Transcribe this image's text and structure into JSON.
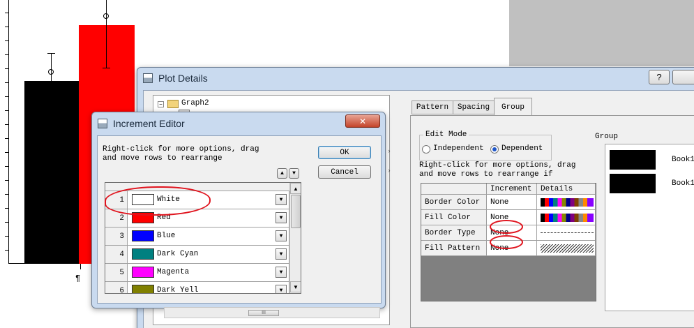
{
  "background_graph": {
    "paragraph_mark": "¶",
    "bar_colors": [
      "#000000",
      "#ff0000"
    ]
  },
  "plot_details": {
    "title": "Plot Details",
    "help_button": "?",
    "tree_item": "Graph2",
    "tabs": [
      "Pattern",
      "Spacing",
      "Group"
    ],
    "active_tab": "Group",
    "edit_mode": {
      "label": "Edit Mode",
      "options": [
        "Independent",
        "Dependent"
      ],
      "selected": "Dependent"
    },
    "instructions": [
      "Right-click for more options, drag",
      "and move rows to  rearrange if"
    ],
    "table_headers": [
      "",
      "Increment",
      "Details"
    ],
    "rows": [
      {
        "label": "Border Color",
        "increment": "None"
      },
      {
        "label": "Fill Color",
        "increment": "None"
      },
      {
        "label": "Border Type",
        "increment": "None"
      },
      {
        "label": "Fill Pattern",
        "increment": "None"
      }
    ],
    "group_label": "Group",
    "group_items": [
      "Book1_",
      "Book1_"
    ]
  },
  "increment_editor": {
    "title": "Increment Editor",
    "close_symbol": "✕",
    "instructions": [
      "Right-click for more options, drag",
      "and move rows to  rearrange"
    ],
    "ok_label": "OK",
    "cancel_label": "Cancel",
    "rows": [
      {
        "num": "1",
        "color": "#ffffff",
        "name": "White"
      },
      {
        "num": "2",
        "color": "#ff0000",
        "name": "Red"
      },
      {
        "num": "3",
        "color": "#0000ff",
        "name": "Blue"
      },
      {
        "num": "4",
        "color": "#008080",
        "name": "Dark Cyan"
      },
      {
        "num": "5",
        "color": "#ff00ff",
        "name": "Magenta"
      },
      {
        "num": "6",
        "color": "#808000",
        "name": "Dark Yell"
      }
    ],
    "scroll_mark": "III"
  },
  "colors": {
    "accent_red": "#e0141e",
    "window_frame": "#c9daef"
  }
}
